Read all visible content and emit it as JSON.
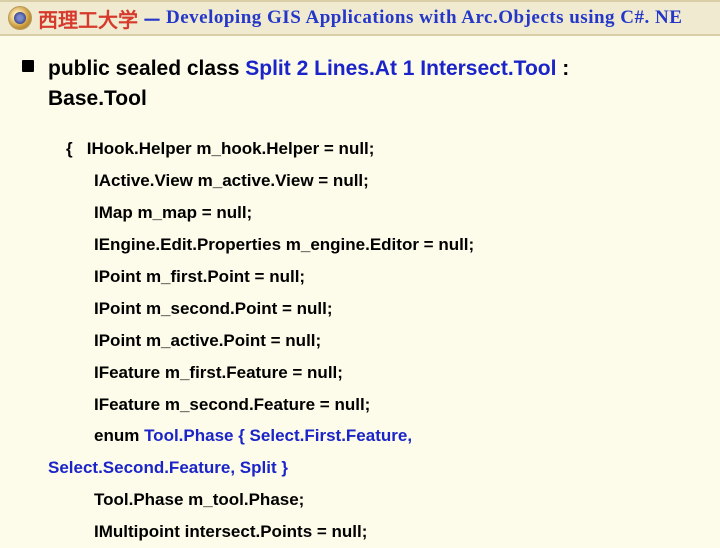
{
  "header": {
    "cn_prefix": "西理工大学",
    "separator": "－",
    "en_title": "Developing GIS Applications with Arc.Objects using C#. NE"
  },
  "class_decl": {
    "prefix_kw": "public sealed class ",
    "name": "Split 2 Lines.At 1 Intersect.Tool",
    "colon": " : ",
    "base": "Base.Tool"
  },
  "body": {
    "open": "{   ",
    "l1": "IHook.Helper m_hook.Helper = null;",
    "l2": "IActive.View m_active.View = null;",
    "l3": "IMap m_map = null;",
    "l4": "IEngine.Edit.Properties m_engine.Editor = null;",
    "l5": "IPoint m_first.Point = null;",
    "l6": "IPoint m_second.Point = null;",
    "l7": "IPoint m_active.Point = null;",
    "l8": "IFeature m_first.Feature = null;",
    "l9": "IFeature m_second.Feature = null;",
    "l10_kw": "enum ",
    "l10_vals": "Tool.Phase { Select.First.Feature,",
    "l11_vals": "Select.Second.Feature, Split }",
    "l12": "Tool.Phase m_tool.Phase;",
    "l13": "IMultipoint intersect.Points = null;"
  }
}
